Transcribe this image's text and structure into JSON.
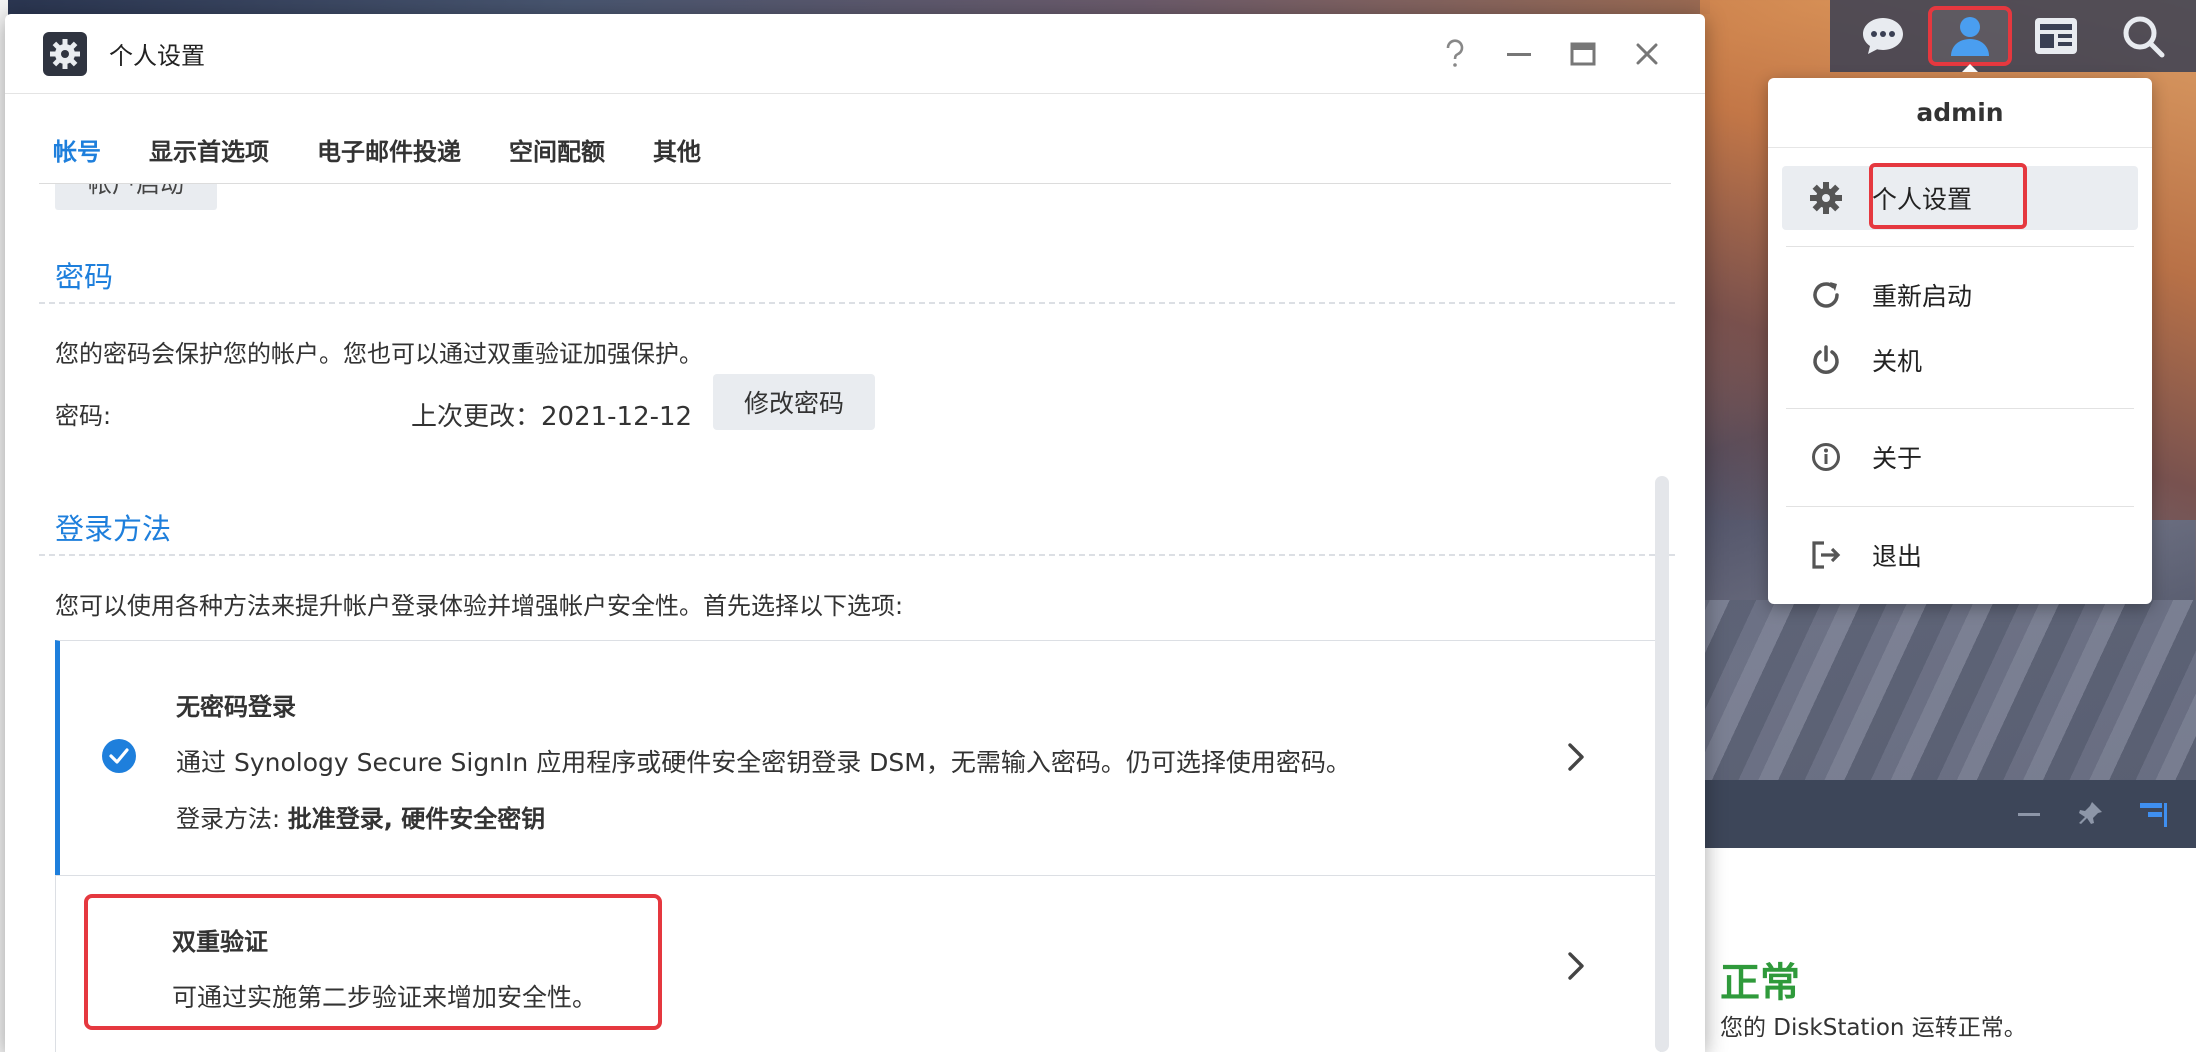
{
  "window": {
    "title": "个人设置",
    "controls": [
      "help-icon",
      "minimize-icon",
      "maximize-icon",
      "close-icon"
    ]
  },
  "tabs": [
    {
      "label": "帐号",
      "active": true
    },
    {
      "label": "显示首选项",
      "active": false
    },
    {
      "label": "电子邮件投递",
      "active": false
    },
    {
      "label": "空间配额",
      "active": false
    },
    {
      "label": "其他",
      "active": false
    }
  ],
  "account": {
    "cut_button_label": "帐户启动"
  },
  "password": {
    "section_title": "密码",
    "description": "您的密码会保护您的帐户。您也可以通过双重验证加强保护。",
    "label": "密码:",
    "last_changed": "上次更改：2021-12-12",
    "change_button": "修改密码"
  },
  "login": {
    "section_title": "登录方法",
    "description": "您可以使用各种方法来提升帐户登录体验并增强帐户安全性。首先选择以下选项:",
    "passwordless": {
      "title": "无密码登录",
      "description": "通过 Synology Secure SignIn 应用程序或硬件安全密钥登录 DSM，无需输入密码。仍可选择使用密码。",
      "meta_label": "登录方法: ",
      "meta_value": "批准登录, 硬件安全密钥",
      "enabled": true
    },
    "two_factor": {
      "title": "双重验证",
      "description": "可通过实施第二步验证来增加安全性。"
    }
  },
  "taskbar": {
    "icons": [
      "chat-icon",
      "user-icon",
      "widget-icon",
      "search-icon"
    ],
    "active": "user-icon"
  },
  "user_menu": {
    "username": "admin",
    "items": [
      {
        "label": "个人设置",
        "icon": "gear-icon"
      },
      {
        "label": "重新启动",
        "icon": "restart-icon"
      },
      {
        "label": "关机",
        "icon": "power-icon"
      },
      {
        "label": "关于",
        "icon": "info-icon"
      },
      {
        "label": "退出",
        "icon": "logout-icon"
      }
    ]
  },
  "widget": {
    "status": "正常",
    "description": "您的 DiskStation 运转正常。"
  },
  "colors": {
    "accent": "#1e7fdc",
    "highlight": "#e5383f",
    "status_ok": "#2f9a3b"
  }
}
